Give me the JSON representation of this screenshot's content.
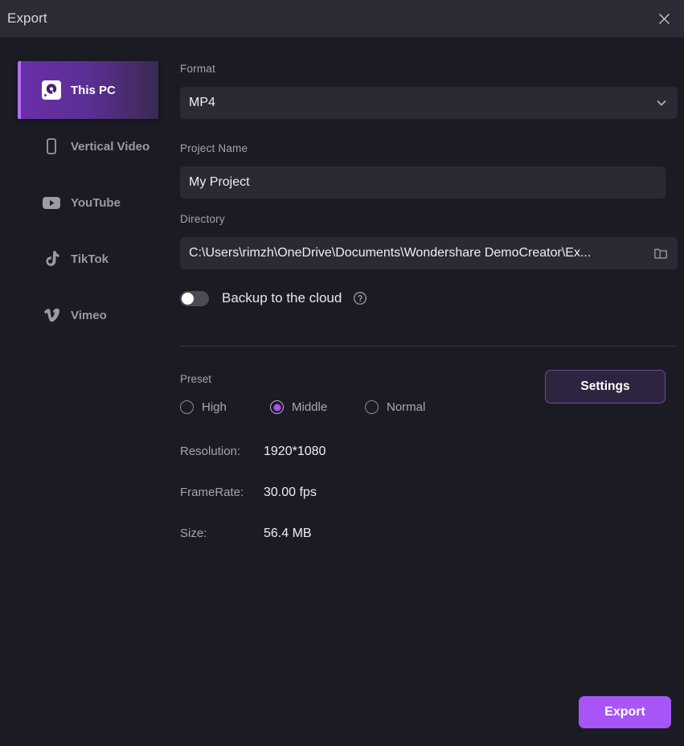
{
  "window": {
    "title": "Export",
    "close_icon": "close-icon"
  },
  "sidebar": {
    "items": [
      {
        "label": "This PC",
        "icon": "hard-drive-icon",
        "selected": true
      },
      {
        "label": "Vertical Video",
        "icon": "phone-icon",
        "selected": false
      },
      {
        "label": "YouTube",
        "icon": "youtube-icon",
        "selected": false
      },
      {
        "label": "TikTok",
        "icon": "tiktok-icon",
        "selected": false
      },
      {
        "label": "Vimeo",
        "icon": "vimeo-icon",
        "selected": false
      }
    ]
  },
  "form": {
    "format_label": "Format",
    "format_value": "MP4",
    "format_chevron_icon": "chevron-down-icon",
    "project_name_label": "Project Name",
    "project_name_value": "My Project",
    "directory_label": "Directory",
    "directory_value": "C:\\Users\\rimzh\\OneDrive\\Documents\\Wondershare DemoCreator\\Ex...",
    "directory_browse_icon": "folder-icon",
    "backup_label": "Backup to the cloud",
    "backup_enabled": false,
    "backup_help_icon": "help-circle-icon"
  },
  "preset": {
    "label": "Preset",
    "options": [
      {
        "label": "High",
        "selected": false
      },
      {
        "label": "Middle",
        "selected": true
      },
      {
        "label": "Normal",
        "selected": false
      }
    ],
    "settings_button": "Settings"
  },
  "info": [
    {
      "key": "Resolution:",
      "value": "1920*1080"
    },
    {
      "key": "FrameRate:",
      "value": "30.00 fps"
    },
    {
      "key": "Size:",
      "value": "56.4 MB"
    }
  ],
  "footer": {
    "export_button": "Export"
  },
  "colors": {
    "background": "#1b1b24",
    "titlebar": "#2b2b35",
    "input": "#2a2a35",
    "accent": "#a855f7",
    "accent_selected_gradient_start": "#6b2ea8",
    "accent_bar": "#b36ef5",
    "divider": "#33333f",
    "label_text": "#a3a3b2",
    "value_text": "#eeeef4"
  }
}
